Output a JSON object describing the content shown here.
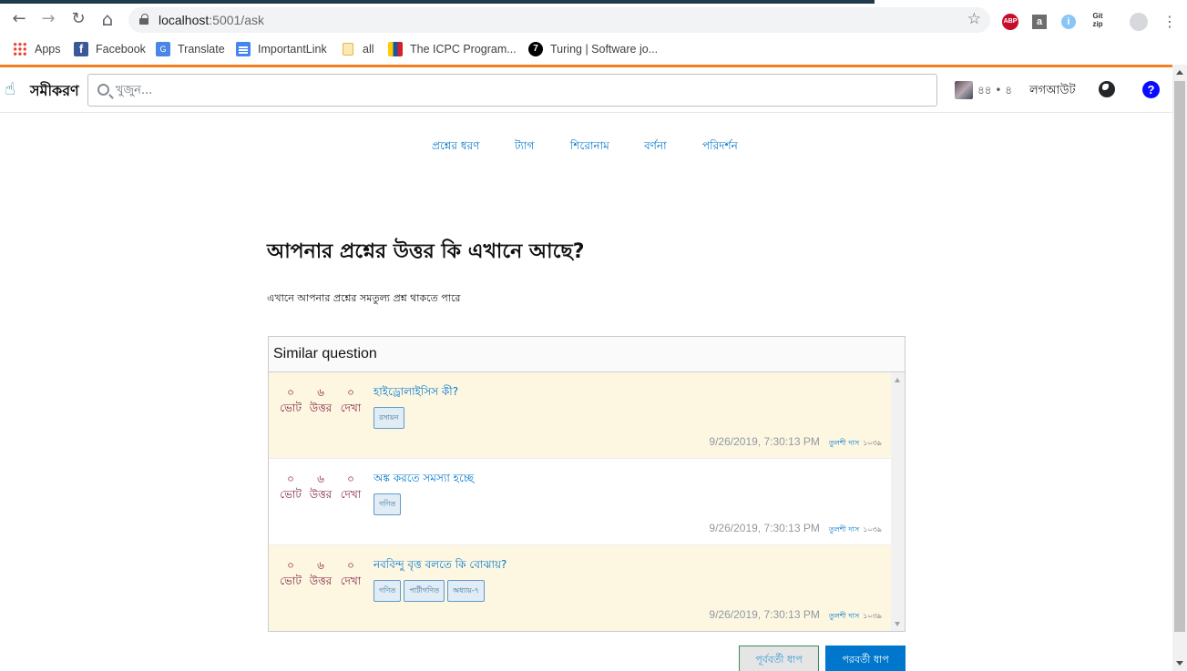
{
  "browser": {
    "url_host": "localhost",
    "url_path": ":5001/ask",
    "back_icon": "←",
    "forward_icon": "→",
    "reload_icon": "↻",
    "home_icon": "⌂",
    "star_icon": "☆",
    "extensions": {
      "abp": "ABP",
      "a": "a",
      "info": "i",
      "gitzip": "Git\nzip"
    },
    "menu_icon": "⋮"
  },
  "bookmarks": [
    {
      "label": "Apps",
      "icon": "apps-icon"
    },
    {
      "label": "Facebook",
      "icon": "facebook-icon",
      "glyph": "f"
    },
    {
      "label": "Translate",
      "icon": "translate-icon",
      "glyph": "G"
    },
    {
      "label": "ImportantLink",
      "icon": "doc-icon"
    },
    {
      "label": "all",
      "icon": "folder-icon"
    },
    {
      "label": "The ICPC Program...",
      "icon": "icpc-icon"
    },
    {
      "label": "Turing | Software jo...",
      "icon": "turing-icon",
      "glyph": "7"
    }
  ],
  "site": {
    "logo_icon": "☝",
    "logo_text": "সমীকরণ",
    "search_placeholder": "খুজুন...",
    "reputation": "৪৪ • ৪",
    "logout": "লগআউট",
    "help_glyph": "?"
  },
  "steps": [
    "প্রশ্নের ধরণ",
    "ট্যাগ",
    "শিরোনাম",
    "বর্ণনা",
    "পরিদর্শন"
  ],
  "page": {
    "title": "আপনার প্রশ্নের উত্তর কি এখানে আছে?",
    "subtitle": "এখানে আপনার প্রশ্নের সমতুল্য প্রশ্ন থাকতে পারে"
  },
  "similar": {
    "header": "Similar question",
    "labels": {
      "votes": "ভোট",
      "answers": "উত্তর",
      "views": "দেখা"
    },
    "questions": [
      {
        "votes": "০",
        "answers": "৬",
        "views": "০",
        "title": "হাইড্রোলাইসিস কী?",
        "tags": [
          "রসায়ন"
        ],
        "date": "9/26/2019, 7:30:13 PM",
        "user": "তুলশী দাস",
        "user_rep": "১০৩৯"
      },
      {
        "votes": "০",
        "answers": "৬",
        "views": "০",
        "title": "অঙ্ক করতে সমস্যা হচ্ছে",
        "tags": [
          "গণিত"
        ],
        "date": "9/26/2019, 7:30:13 PM",
        "user": "তুলশী দাস",
        "user_rep": "১০৩৯"
      },
      {
        "votes": "০",
        "answers": "৬",
        "views": "০",
        "title": "নববিন্দু বৃত্ত বলতে কি বোঝায়?",
        "tags": [
          "গণিত",
          "পাটীগণিত",
          "অধ্যায়-৭"
        ],
        "date": "9/26/2019, 7:30:13 PM",
        "user": "তুলশী দাস",
        "user_rep": "১০৩৯"
      }
    ]
  },
  "buttons": {
    "prev": "পূর্ববর্তী ধাপ",
    "next": "পরবর্তী ধাপ"
  },
  "colors": {
    "accent": "#0077cc",
    "orange_bar": "#f48024",
    "highlight_row": "#fdf7e2"
  }
}
